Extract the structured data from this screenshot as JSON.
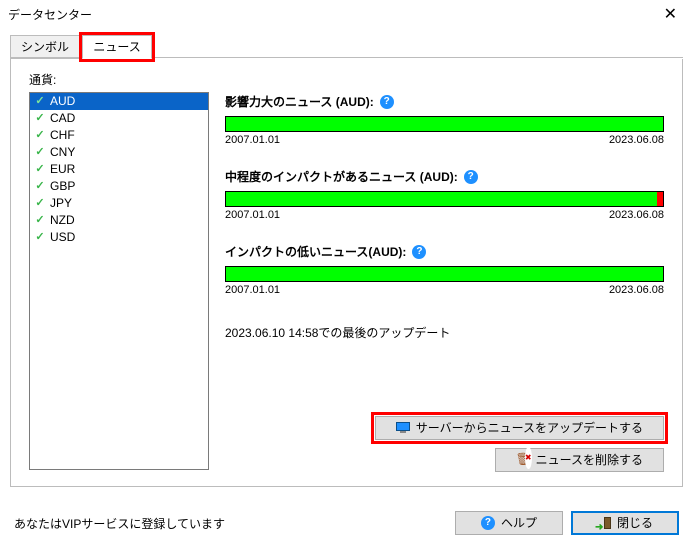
{
  "window": {
    "title": "データセンター"
  },
  "tabs": {
    "symbol": "シンボル",
    "news": "ニュース"
  },
  "currency": {
    "label": "通貨:",
    "items": [
      "AUD",
      "CAD",
      "CHF",
      "CNY",
      "EUR",
      "GBP",
      "JPY",
      "NZD",
      "USD"
    ],
    "selected_index": 0
  },
  "news_sections": {
    "high": {
      "title": "影響力大のニュース (AUD):",
      "start": "2007.01.01",
      "end": "2023.06.08",
      "red_tail": false
    },
    "medium": {
      "title": "中程度のインパクトがあるニュース (AUD):",
      "start": "2007.01.01",
      "end": "2023.06.08",
      "red_tail": true
    },
    "low": {
      "title": "インパクトの低いニュース(AUD):",
      "start": "2007.01.01",
      "end": "2023.06.08",
      "red_tail": false
    }
  },
  "last_update": "2023.06.10 14:58での最後のアップデート",
  "buttons": {
    "update_from_server": "サーバーからニュースをアップデートする",
    "delete_news": "ニュースを削除する",
    "help": "ヘルプ",
    "close": "閉じる"
  },
  "footer": {
    "vip_status": "あなたはVIPサービスに登録しています"
  }
}
